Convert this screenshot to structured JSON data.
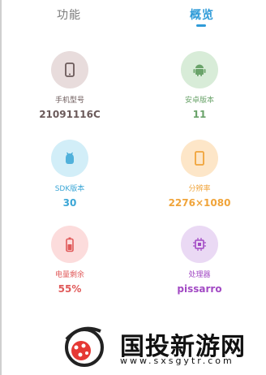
{
  "tabs": {
    "functions": "功能",
    "overview": "概览"
  },
  "tiles": [
    {
      "label": "手机型号",
      "value": "21091116C",
      "icon": "phone-icon",
      "circle_color": "#e8dcdc",
      "icon_color": "#6b5a5a",
      "label_color": "#6b5a5a",
      "value_color": "#6b5a5a"
    },
    {
      "label": "安卓版本",
      "value": "11",
      "icon": "android-icon",
      "circle_color": "#d8ecd8",
      "icon_color": "#6aa36a",
      "label_color": "#6aa36a",
      "value_color": "#6aa36a"
    },
    {
      "label": "SDK版本",
      "value": "30",
      "icon": "sdk-icon",
      "circle_color": "#d2eef8",
      "icon_color": "#3aa6d6",
      "label_color": "#3aa6d6",
      "value_color": "#3aa6d6"
    },
    {
      "label": "分辨率",
      "value": "2276×1080",
      "icon": "screen-icon",
      "circle_color": "#fde6c8",
      "icon_color": "#f0a43a",
      "label_color": "#f0a43a",
      "value_color": "#f0a43a"
    },
    {
      "label": "电量剩余",
      "value": "55%",
      "icon": "battery-icon",
      "circle_color": "#fcdcdc",
      "icon_color": "#e05a5a",
      "label_color": "#e05a5a",
      "value_color": "#e05a5a"
    },
    {
      "label": "处理器",
      "value": "pissarro",
      "icon": "cpu-icon",
      "circle_color": "#ead9f4",
      "icon_color": "#a24ac4",
      "label_color": "#a24ac4",
      "value_color": "#a24ac4"
    }
  ],
  "watermark": {
    "title": "国投新游网",
    "url": "www.sxsgytr.com"
  }
}
